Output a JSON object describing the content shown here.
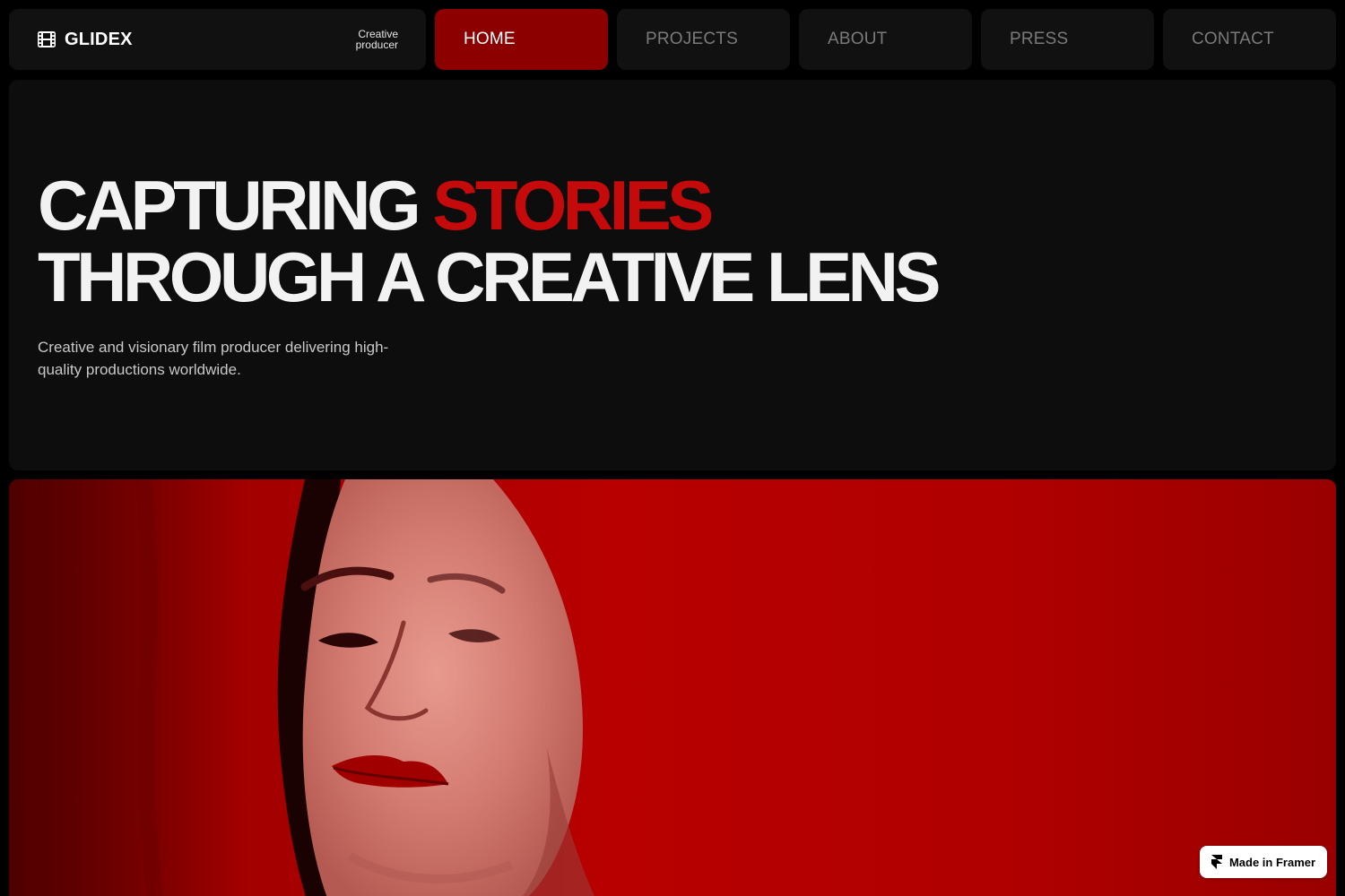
{
  "brand": {
    "name": "GLIDEX",
    "tagline_line1": "Creative",
    "tagline_line2": "producer",
    "icon": "film-icon"
  },
  "nav": {
    "items": [
      {
        "label": "HOME",
        "active": true
      },
      {
        "label": "PROJECTS",
        "active": false
      },
      {
        "label": "ABOUT",
        "active": false
      },
      {
        "label": "PRESS",
        "active": false
      },
      {
        "label": "CONTACT",
        "active": false
      }
    ]
  },
  "hero": {
    "headline_part1": "CAPTURING",
    "headline_accent": "STORIES",
    "headline_line2": "THROUGH A CREATIVE LENS",
    "subtext": "Creative and visionary film producer delivering high-quality productions worldwide."
  },
  "image": {
    "alt": "Portrait of a woman tinted red",
    "icon": "portrait-image"
  },
  "badge": {
    "label": "Made in Framer",
    "icon": "framer-icon"
  },
  "colors": {
    "accent": "#c40a0a",
    "active_nav": "#8c0000",
    "panel": "#111111",
    "background": "#000000"
  }
}
